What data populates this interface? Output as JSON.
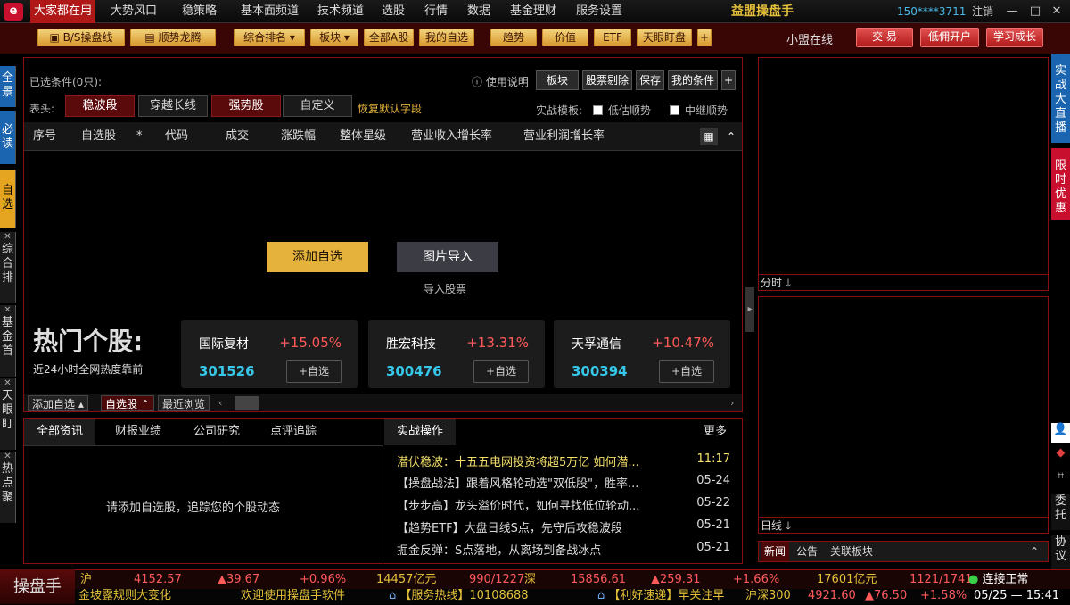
{
  "topmenu": {
    "logo": "e",
    "items": [
      "大家都在用",
      "大势风口",
      "稳策略",
      "基本面频道",
      "技术频道",
      "选股",
      "行情",
      "数据",
      "基金理财",
      "服务设置"
    ],
    "brand": "益盟操盘手",
    "user": "150****3711",
    "logout": "注销"
  },
  "toolbar": {
    "items": [
      "B/S操盘线",
      "顺势龙腾",
      "综合排名",
      "板块",
      "全部A股",
      "我的自选",
      "趋势",
      "价值",
      "ETF",
      "天眼盯盘",
      "+"
    ],
    "online": "小盟在线",
    "right": [
      "交 易",
      "低佣开户",
      "学习成长"
    ]
  },
  "left_tabs": [
    "全景",
    "必读",
    "自选",
    "综合排",
    "基金首",
    "天眼盯",
    "热点聚"
  ],
  "panel": {
    "conditions": "已选条件(0只):",
    "help": "使用说明",
    "buttons": [
      "板块",
      "股票剔除",
      "保存",
      "我的条件",
      "+"
    ],
    "header_label": "表头:",
    "header_tabs": [
      "稳波段",
      "穿越长线",
      "强势股",
      "自定义"
    ],
    "restore": "恢复默认字段",
    "template_label": "实战模板:",
    "template_opts": [
      "低估顺势",
      "中继顺势"
    ],
    "columns": [
      "序号",
      "自选股",
      "*",
      "代码",
      "成交",
      "涨跌幅",
      "整体星级",
      "营业收入增长率",
      "营业利润增长率"
    ],
    "add_btn": "添加自选",
    "import_btn": "图片导入",
    "import_label": "导入股票",
    "hot_title": "热门个股:",
    "hot_sub": "近24小时全网热度靠前",
    "hot": [
      {
        "name": "国际复材",
        "pct": "+15.05%",
        "code": "301526",
        "add": "+自选"
      },
      {
        "name": "胜宏科技",
        "pct": "+13.31%",
        "code": "300476",
        "add": "+自选"
      },
      {
        "name": "天孚通信",
        "pct": "+10.47%",
        "code": "300394",
        "add": "+自选"
      }
    ],
    "subtabs": [
      "添加自选",
      "自选股",
      "最近浏览"
    ]
  },
  "news": {
    "tabs": [
      "全部资讯",
      "财报业绩",
      "公司研究",
      "点评追踪"
    ],
    "right_tab": "实战操作",
    "more": "更多",
    "empty": "请添加自选股，追踪您的个股动态",
    "items": [
      {
        "title": "潜伏稳波：十五五电网投资将超5万亿 如何潜...",
        "date": "11:17"
      },
      {
        "title": "【操盘战法】跟着风格轮动选\"双低股\"，胜率...",
        "date": "05-24"
      },
      {
        "title": "【步步高】龙头溢价时代，如何寻找低位轮动...",
        "date": "05-22"
      },
      {
        "title": "【趋势ETF】大盘日线S点，先守后攻稳波段",
        "date": "05-21"
      },
      {
        "title": "掘金反弹：S点落地，从离场到备战冰点",
        "date": "05-21"
      }
    ]
  },
  "right": {
    "chart1_label": "分时",
    "chart2_label": "日线",
    "tabs": [
      "新闻",
      "公告",
      "关联板块"
    ],
    "side_top": "实战大直播",
    "side_mid": "限时优惠",
    "side_bottom": [
      "委托",
      "协议"
    ]
  },
  "status": {
    "op": "操盘手",
    "sh_label": "沪",
    "sh_index": "4152.57",
    "sh_chg": "▲39.67",
    "sh_pct": "+0.96%",
    "sh_amt": "14457亿元",
    "sh_ud": "990/1227",
    "sz_label": "深",
    "sz_index": "15856.61",
    "sz_chg": "▲259.31",
    "sz_pct": "+1.66%",
    "sz_amt": "17601亿元",
    "sz_ud": "1121/1741",
    "conn": "连接正常",
    "ticker1": "金坡露规则大变化",
    "ticker2": "欢迎使用操盘手软件",
    "ticker3": "【服务热线】10108688",
    "ticker4": "【利好速递】早关注早",
    "idx300": "沪深300",
    "idx300_v": "4921.60",
    "idx300_c": "▲76.50",
    "idx300_p": "+1.58%",
    "date": "05/25",
    "time": "15:41"
  },
  "colors": {
    "accent_red": "#8a0f0f",
    "gold": "#e5b23c",
    "up": "#ff5a5a",
    "code": "#35c6e8"
  }
}
